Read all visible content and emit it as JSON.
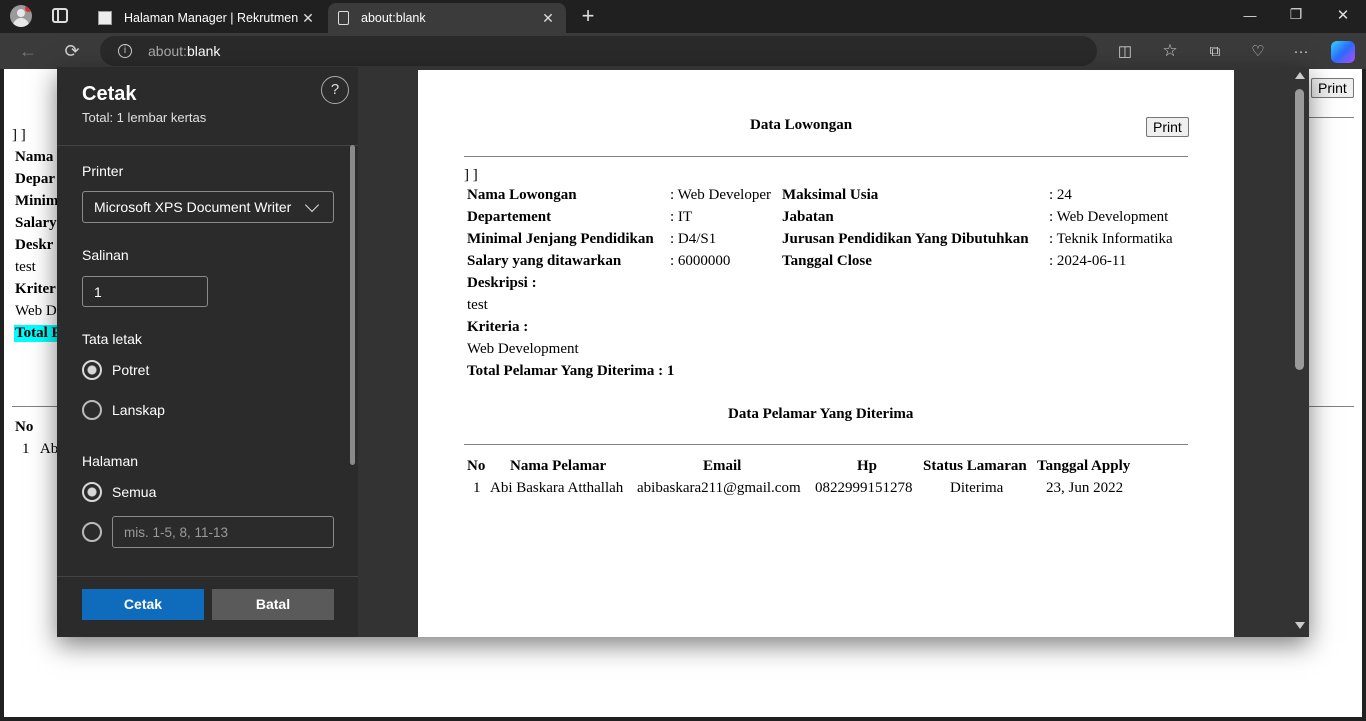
{
  "browser": {
    "tabs": [
      {
        "label": "Halaman Manager | Rekrutmen K",
        "active": false
      },
      {
        "label": "about:blank",
        "active": true
      }
    ],
    "url_prefix": "about:",
    "url_host": "blank",
    "window_buttons": {
      "minimize": "—",
      "maximize": "❐",
      "close": "✕"
    }
  },
  "print_dialog": {
    "title": "Cetak",
    "total": "Total: 1 lembar kertas",
    "help": "?",
    "printer_label": "Printer",
    "printer_value": "Microsoft XPS Document Writer",
    "copies_label": "Salinan",
    "copies_value": "1",
    "layout_label": "Tata letak",
    "layout_options": [
      "Potret",
      "Lanskap"
    ],
    "pages_label": "Halaman",
    "pages_all": "Semua",
    "pages_placeholder": "mis. 1-5, 8, 11-13",
    "print_button": "Cetak",
    "cancel_button": "Batal"
  },
  "document": {
    "title": "Data Lowongan",
    "print_button": "Print",
    "brackets": "] ]",
    "fields": {
      "nama_lowongan_label": "Nama Lowongan",
      "nama_lowongan_value": ": Web Developer",
      "maksimal_usia_label": "Maksimal Usia",
      "maksimal_usia_value": ": 24",
      "departement_label": "Departement",
      "departement_value": ": IT",
      "jabatan_label": "Jabatan",
      "jabatan_value": ": Web Development",
      "jenjang_label": "Minimal Jenjang Pendidikan",
      "jenjang_value": ": D4/S1",
      "jurusan_label": "Jurusan Pendidikan Yang Dibutuhkan",
      "jurusan_value": ": Teknik Informatika",
      "salary_label": "Salary yang ditawarkan",
      "salary_value": ": 6000000",
      "close_label": "Tanggal Close",
      "close_value": ": 2024-06-11"
    },
    "deskripsi_label": "Deskripsi :",
    "deskripsi_value": "test",
    "kriteria_label": "Kriteria :",
    "kriteria_value": "Web Development",
    "total_label": "Total Pelamar Yang Diterima : 1",
    "applicants_title": "Data Pelamar Yang Diterima",
    "table_headers": [
      "No",
      "Nama Pelamar",
      "Email",
      "Hp",
      "Status Lamaran",
      "Tanggal Apply"
    ],
    "table_rows": [
      [
        "1",
        "Abi Baskara Atthallah",
        "abibaskara211@gmail.com",
        "0822999151278",
        "Diterima",
        "23, Jun 2022"
      ]
    ]
  },
  "background_page": {
    "brackets": "] ]",
    "labels": [
      "Nama",
      "Depar",
      "Minim",
      "Salary",
      "Deskr"
    ],
    "test": "test",
    "kriteria": "Kriter",
    "web": "Web D",
    "total": "Total P",
    "no": "No",
    "row": "1   Ab",
    "print_button": "Print"
  },
  "colors": {
    "accent": "#0f6cbd",
    "highlight": "#00ffff"
  }
}
